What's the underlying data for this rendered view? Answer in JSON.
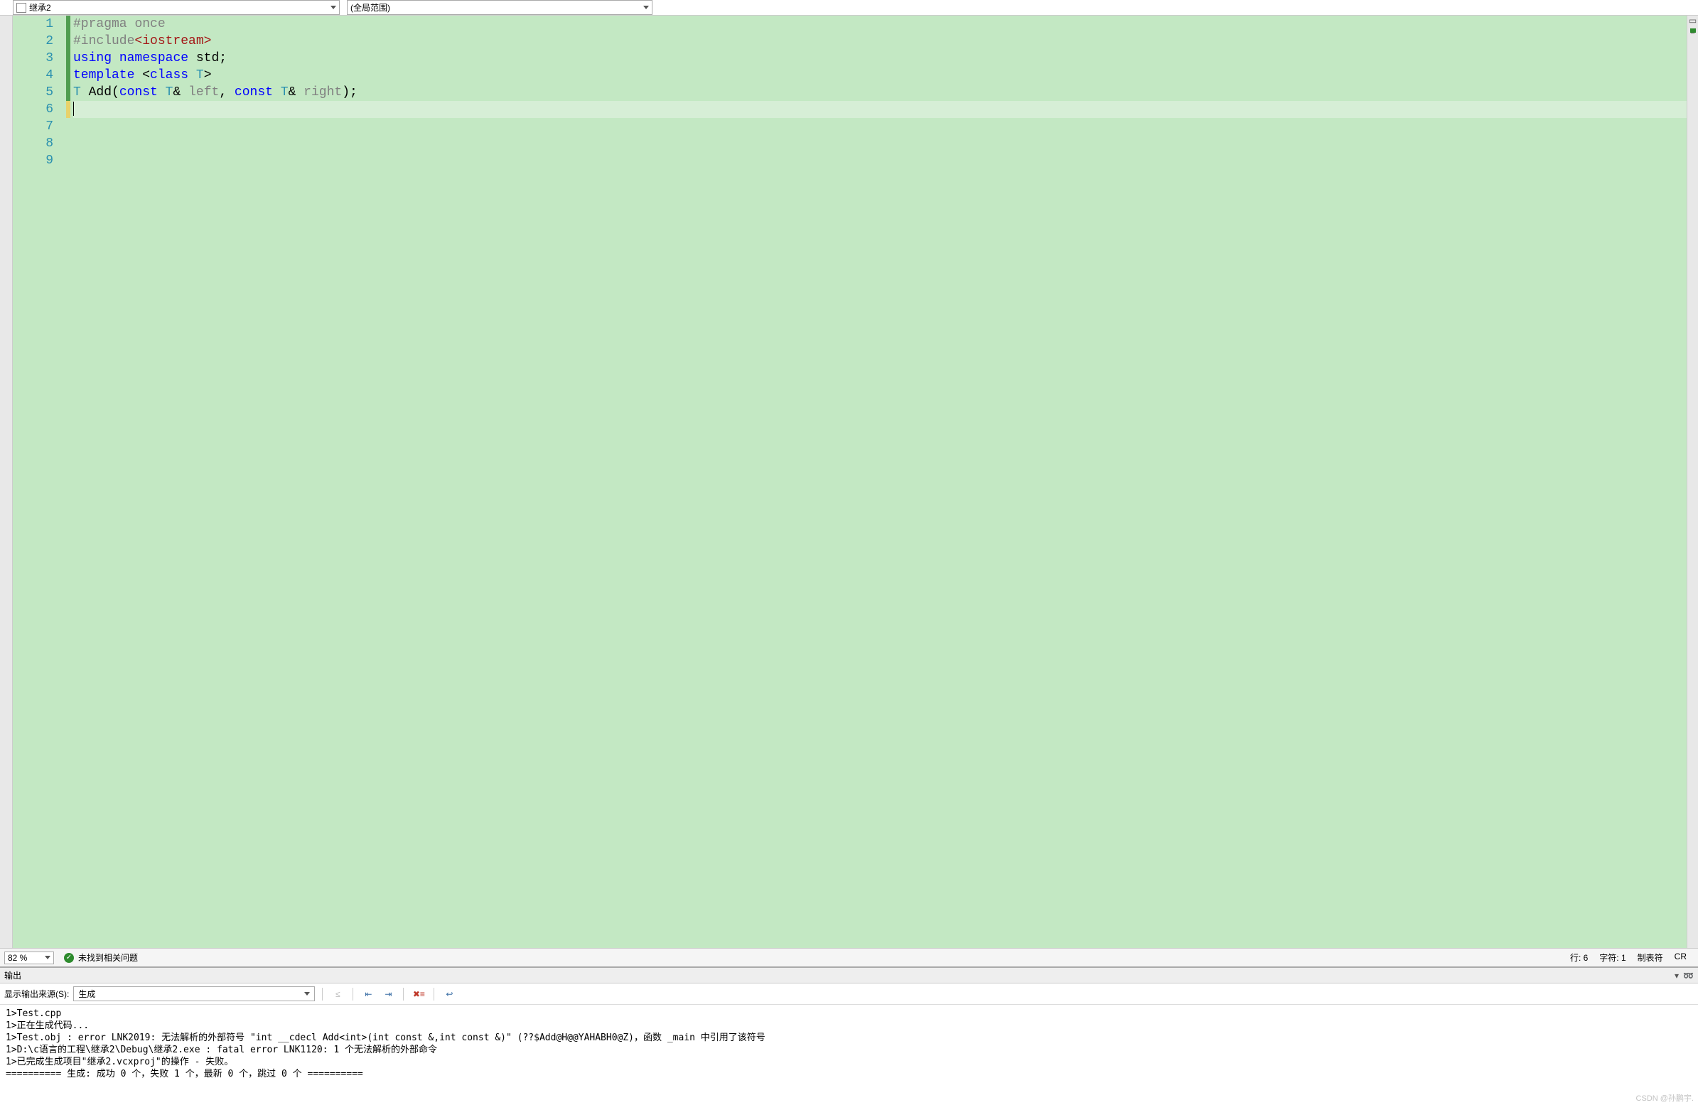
{
  "topbar": {
    "file_dropdown": "继承2",
    "scope_dropdown": "(全局范围)"
  },
  "code": {
    "lines": [
      {
        "n": "1",
        "html": "<span class='tok-pp'>#pragma</span> <span class='tok-pp'>once</span>"
      },
      {
        "n": "2",
        "html": "<span class='tok-pp'>#include</span><span class='tok-inc'>&lt;iostream&gt;</span>"
      },
      {
        "n": "3",
        "html": "<span class='tok-kw'>using</span> <span class='tok-kw'>namespace</span> <span class='tok-plain'>std;</span>"
      },
      {
        "n": "4",
        "html": "<span class='tok-kw'>template</span> <span class='tok-plain'>&lt;</span><span class='tok-kw'>class</span> <span class='tok-type'>T</span><span class='tok-plain'>&gt;</span>"
      },
      {
        "n": "5",
        "html": "<span class='tok-type'>T</span> <span class='tok-plain'>Add(</span><span class='tok-kw'>const</span> <span class='tok-type'>T</span><span class='tok-plain'>&amp; </span><span class='tok-param'>left</span><span class='tok-plain'>, </span><span class='tok-kw'>const</span> <span class='tok-type'>T</span><span class='tok-plain'>&amp; </span><span class='tok-param'>right</span><span class='tok-plain'>);</span>"
      },
      {
        "n": "6",
        "html": ""
      },
      {
        "n": "7",
        "html": ""
      },
      {
        "n": "8",
        "html": ""
      },
      {
        "n": "9",
        "html": ""
      }
    ],
    "change_marks": [
      "green",
      "green",
      "green",
      "green",
      "green",
      "yellow",
      "",
      "",
      ""
    ]
  },
  "status": {
    "zoom": "82 %",
    "issues_text": "未找到相关问题",
    "line": "行: 6",
    "char": "字符: 1",
    "tabs": "制表符",
    "crlf": "CR"
  },
  "output": {
    "panel_title": "输出",
    "source_label": "显示输出来源(S):",
    "source_value": "生成",
    "lines": [
      "1>Test.cpp",
      "1>正在生成代码...",
      "1>Test.obj : error LNK2019: 无法解析的外部符号 \"int __cdecl Add<int>(int const &,int const &)\" (??$Add@H@@YAHABH0@Z)，函数 _main 中引用了该符号",
      "1>D:\\c语言的工程\\继承2\\Debug\\继承2.exe : fatal error LNK1120: 1 个无法解析的外部命令",
      "1>已完成生成项目\"继承2.vcxproj\"的操作 - 失败。",
      "========== 生成: 成功 0 个，失败 1 个，最新 0 个，跳过 0 个 =========="
    ]
  },
  "watermark": "CSDN @孙鹏宇."
}
